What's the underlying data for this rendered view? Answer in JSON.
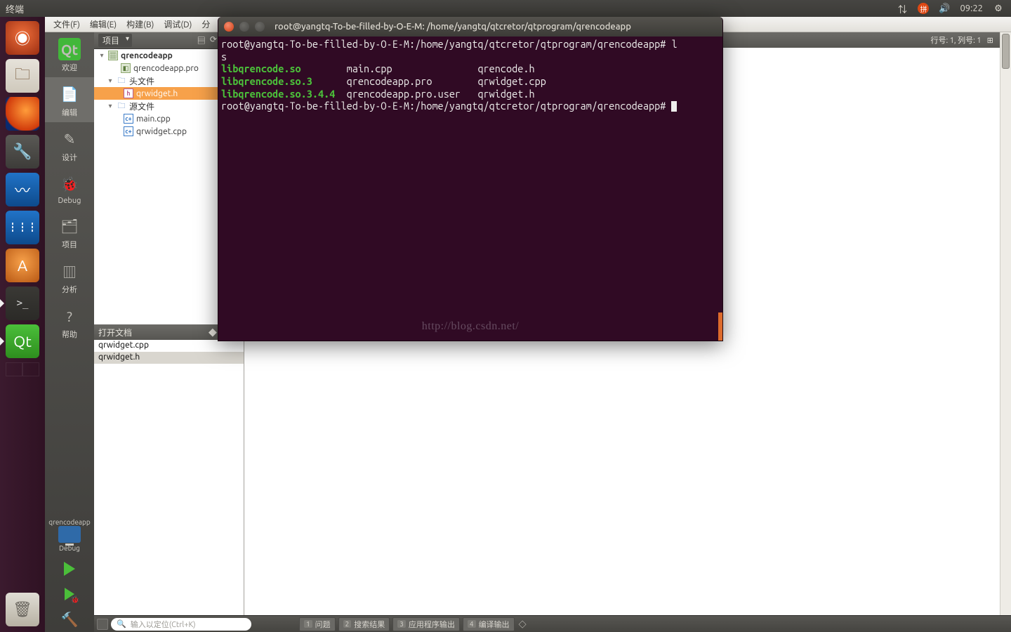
{
  "panel": {
    "title": "终端",
    "time": "09:22"
  },
  "launcher": {
    "items": [
      {
        "name": "dash",
        "glyph": "◎"
      },
      {
        "name": "files",
        "glyph": "🗀"
      },
      {
        "name": "firefox",
        "glyph": ""
      },
      {
        "name": "settings",
        "glyph": "⚙"
      },
      {
        "name": "monitor",
        "glyph": "〰"
      },
      {
        "name": "update",
        "glyph": "⎋"
      },
      {
        "name": "updater",
        "glyph": "A"
      },
      {
        "name": "terminal",
        "glyph": ">_"
      },
      {
        "name": "qt",
        "glyph": "Qt"
      }
    ],
    "trash_glyph": "🗑"
  },
  "qtc": {
    "menus": [
      "文件(F)",
      "编辑(E)",
      "构建(B)",
      "调试(D)",
      "分"
    ],
    "modes": [
      {
        "key": "welcome",
        "label": "欢迎"
      },
      {
        "key": "edit",
        "label": "编辑"
      },
      {
        "key": "design",
        "label": "设计"
      },
      {
        "key": "debug",
        "label": "Debug"
      },
      {
        "key": "projects",
        "label": "项目"
      },
      {
        "key": "analyze",
        "label": "分析"
      },
      {
        "key": "help",
        "label": "帮助"
      }
    ],
    "target": {
      "name": "qrencodeapp",
      "config": "Debug"
    },
    "project_combo": "项目",
    "tree": {
      "root": "qrencodeapp",
      "pro": "qrencodeapp.pro",
      "headers_label": "头文件",
      "headers": [
        "qrwidget.h"
      ],
      "sources_label": "源文件",
      "sources": [
        "main.cpp",
        "qrwidget.cpp"
      ]
    },
    "open_docs": {
      "title": "打开文档",
      "items": [
        "qrwidget.cpp",
        "qrwidget.h"
      ]
    },
    "editor_status": {
      "nav": "◂ ▸",
      "pos": "行号: 1, 列号: 1"
    },
    "bottom": {
      "search_placeholder": "输入以定位(Ctrl+K)",
      "tabs": [
        {
          "n": "1",
          "t": "问题"
        },
        {
          "n": "2",
          "t": "搜索结果"
        },
        {
          "n": "3",
          "t": "应用程序输出"
        },
        {
          "n": "4",
          "t": "编译输出"
        }
      ]
    }
  },
  "terminal": {
    "title": "root@yangtq-To-be-filled-by-O-E-M: /home/yangtq/qtcretor/qtprogram/qrencodeapp",
    "prompt": "root@yangtq-To-be-filled-by-O-E-M:/home/yangtq/qtcretor/qtprogram/qrencodeapp#",
    "cmd1": "l",
    "cmd1b": "s",
    "ls_rows": [
      {
        "c1": "libqrencode.so",
        "c2": "main.cpp",
        "c3": "qrencode.h"
      },
      {
        "c1": "libqrencode.so.3",
        "c2": "qrencodeapp.pro",
        "c3": "qrwidget.cpp"
      },
      {
        "c1": "libqrencode.so.3.4.4",
        "c2": "qrencodeapp.pro.user",
        "c3": "qrwidget.h"
      }
    ],
    "watermark": "http://blog.csdn.net/"
  }
}
